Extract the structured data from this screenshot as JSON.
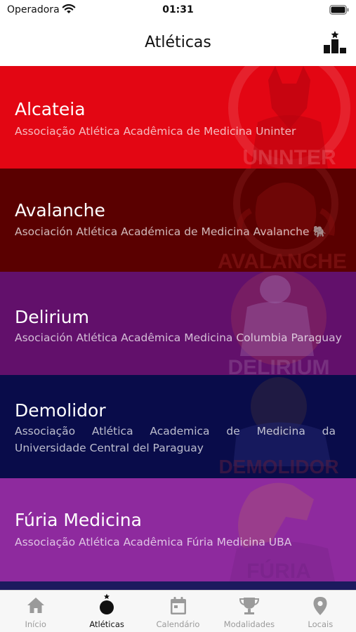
{
  "status_bar": {
    "carrier": "Operadora",
    "time": "01:31"
  },
  "nav": {
    "title": "Atléticas",
    "ranking_icon": "ranking-podium-icon"
  },
  "cards": [
    {
      "name": "Alcateia",
      "subtitle": "Associação Atlética Acadêmica de Medicina Uninter",
      "color": "#e30613",
      "mascot_text": "UNINTER"
    },
    {
      "name": "Avalanche",
      "subtitle": "Asociación Atlética Académica de Medicina Avalanche 🐘",
      "color": "#5a0000",
      "mascot_text": "AVALANCHE"
    },
    {
      "name": "Delirium",
      "subtitle": "Asociación Atlética Acadêmica Medicina Columbia Paraguay",
      "color": "#62106b",
      "mascot_text": "DELIRIUM"
    },
    {
      "name": "Demolidor",
      "subtitle": "Associação Atlética Academica de Medicina da Universidade Central del Paraguay",
      "color": "#090c4a",
      "mascot_text": "DEMOLIDOR"
    },
    {
      "name": "Fúria Medicina",
      "subtitle": "Associação Atlética Acadêmica Fúria Medicina UBA",
      "color": "#8e2a9e",
      "mascot_text": "FÚRIA"
    }
  ],
  "tabs": [
    {
      "label": "Início",
      "icon": "home-icon",
      "active": false
    },
    {
      "label": "Atléticas",
      "icon": "bomb-icon",
      "active": true
    },
    {
      "label": "Calendário",
      "icon": "calendar-icon",
      "active": false
    },
    {
      "label": "Modalidades",
      "icon": "trophy-icon",
      "active": false
    },
    {
      "label": "Locais",
      "icon": "location-pin-icon",
      "active": false
    }
  ],
  "colors": {
    "tab_inactive": "#9a9a9a",
    "tab_active": "#111111"
  }
}
